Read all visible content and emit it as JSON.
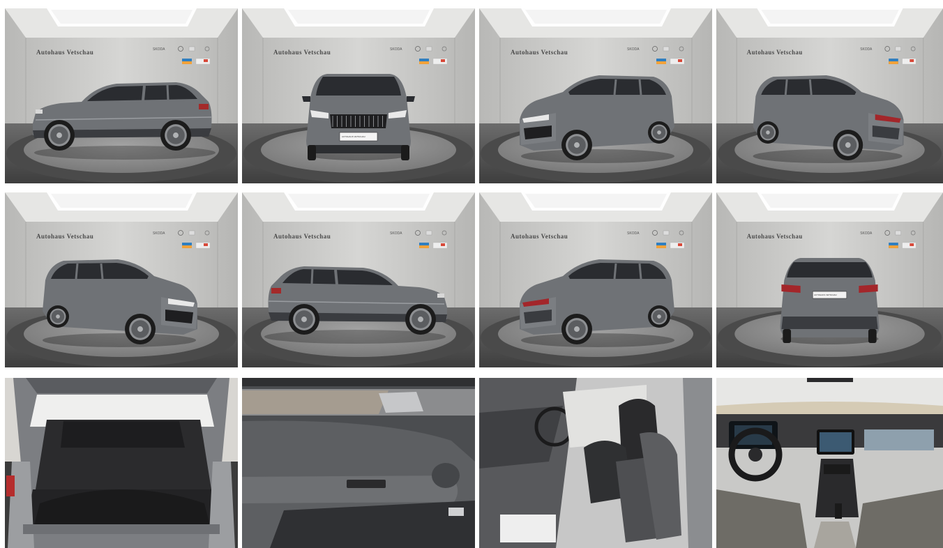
{
  "gallery": {
    "tiles": [
      {
        "id": "side-left",
        "kind": "studio",
        "view": "side-left",
        "dealer": "Autohaus Vetschau",
        "logo": "SKODA"
      },
      {
        "id": "front",
        "kind": "studio",
        "view": "front",
        "dealer": "Autohaus Vetschau",
        "logo": "SKODA",
        "plate": "AUTOHAUS VETSCHAU"
      },
      {
        "id": "front-right",
        "kind": "studio",
        "view": "front-right",
        "dealer": "Autohaus Vetschau",
        "logo": "SKODA"
      },
      {
        "id": "rear-left",
        "kind": "studio",
        "view": "rear-left",
        "dealer": "Autohaus Vetschau",
        "logo": "SKODA"
      },
      {
        "id": "front-left",
        "kind": "studio",
        "view": "front-left",
        "dealer": "Autohaus Vetschau",
        "logo": "SKODA"
      },
      {
        "id": "side-right",
        "kind": "studio",
        "view": "side-right",
        "dealer": "Autohaus Vetschau",
        "logo": "SKODA"
      },
      {
        "id": "rear-right",
        "kind": "studio",
        "view": "rear-right",
        "dealer": "Autohaus Vetschau",
        "logo": "SKODA"
      },
      {
        "id": "rear",
        "kind": "studio",
        "view": "rear",
        "dealer": "Autohaus Vetschau",
        "logo": "SKODA",
        "plate": "AUTOHAUS VETSCHAU"
      },
      {
        "id": "trunk",
        "kind": "trunk"
      },
      {
        "id": "door-panel",
        "kind": "door"
      },
      {
        "id": "front-seats",
        "kind": "seats"
      },
      {
        "id": "dashboard",
        "kind": "dashboard"
      }
    ]
  },
  "colors": {
    "car_body": "#6f7276",
    "car_dark": "#2a2c30",
    "wall": "#c9c9c7",
    "floor": "#5a5a5a",
    "turntable": "#8a8a8a"
  }
}
